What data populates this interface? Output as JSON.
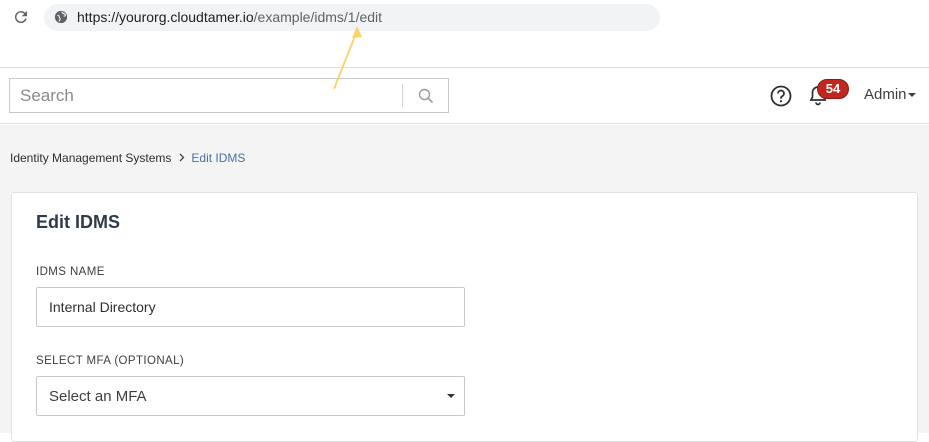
{
  "browser": {
    "url_host": "https://yourorg.cloudtamer.io",
    "url_path": "/example/idms/1/edit"
  },
  "header": {
    "search_placeholder": "Search",
    "notification_count": "54",
    "user_label": "Admin"
  },
  "breadcrumb": {
    "parent": "Identity Management Systems",
    "current": "Edit IDMS"
  },
  "form": {
    "title": "Edit IDMS",
    "name_label": "IDMS NAME",
    "name_value": "Internal Directory",
    "mfa_label": "SELECT MFA (OPTIONAL)",
    "mfa_value": "Select an MFA"
  },
  "colors": {
    "badge": "#c0271e",
    "breadcrumb_current": "#4a6fa5",
    "annotation_arrow": "#f7d36b"
  },
  "icons": [
    "reload-icon",
    "globe-icon",
    "search-icon",
    "help-icon",
    "bell-icon",
    "chevron-down-icon"
  ]
}
